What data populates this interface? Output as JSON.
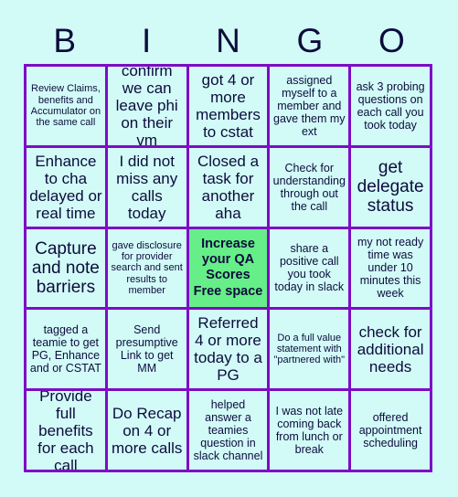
{
  "card": {
    "background_color": "#d2fbf7",
    "grid_border_color": "#7d0cc4",
    "text_color": "#0c0c3c",
    "free_space_color": "#66ee88"
  },
  "header": {
    "letters": [
      {
        "label": "B"
      },
      {
        "label": "I"
      },
      {
        "label": "N"
      },
      {
        "label": "G"
      },
      {
        "label": "O"
      }
    ]
  },
  "grid": {
    "rows": 5,
    "columns": 5,
    "cells": [
      {
        "text": "Review Claims, benefits and Accumulator on the same call",
        "size": "t-xs",
        "free": false
      },
      {
        "text": "confirm we can leave phi on their vm",
        "size": "t-lg",
        "free": false
      },
      {
        "text": "got 4 or more members to cstat",
        "size": "t-lg",
        "free": false
      },
      {
        "text": "assigned myself to a member and gave them my ext",
        "size": "t-sm",
        "free": false
      },
      {
        "text": "ask 3 probing questions on each call you took today",
        "size": "t-sm",
        "free": false
      },
      {
        "text": "Enhance to cha delayed or real time",
        "size": "t-lg",
        "free": false
      },
      {
        "text": "I did not miss any calls today",
        "size": "t-lg",
        "free": false
      },
      {
        "text": "Closed a task for another aha",
        "size": "t-lg",
        "free": false
      },
      {
        "text": "Check for understanding through out the call",
        "size": "t-sm",
        "free": false
      },
      {
        "text": "get delegate status",
        "size": "t-xl",
        "free": false
      },
      {
        "text": "Capture and note barriers",
        "size": "t-xl",
        "free": false
      },
      {
        "text": "gave disclosure for provider search and sent results to member",
        "size": "t-xs",
        "free": false
      },
      {
        "text": "Increase your QA Scores Free space",
        "size": "t-md",
        "free": true
      },
      {
        "text": "share a positive call you took today in slack",
        "size": "t-sm",
        "free": false
      },
      {
        "text": "my not ready time was under 10 minutes this week",
        "size": "t-sm",
        "free": false
      },
      {
        "text": "tagged a teamie to get PG, Enhance and or CSTAT",
        "size": "t-sm",
        "free": false
      },
      {
        "text": "Send presumptive Link to get MM",
        "size": "t-sm",
        "free": false
      },
      {
        "text": "Referred 4 or more today to a PG",
        "size": "t-lg",
        "free": false
      },
      {
        "text": "Do a full value statement with \"partnered with\"",
        "size": "t-xs",
        "free": false
      },
      {
        "text": "check for additional needs",
        "size": "t-lg",
        "free": false
      },
      {
        "text": "Provide full benefits for each call",
        "size": "t-lg",
        "free": false
      },
      {
        "text": "Do Recap on 4 or more calls",
        "size": "t-lg",
        "free": false
      },
      {
        "text": "helped answer a teamies question in slack channel",
        "size": "t-sm",
        "free": false
      },
      {
        "text": "I was not late coming back from lunch or break",
        "size": "t-sm",
        "free": false
      },
      {
        "text": "offered appointment scheduling",
        "size": "t-sm",
        "free": false
      }
    ]
  }
}
